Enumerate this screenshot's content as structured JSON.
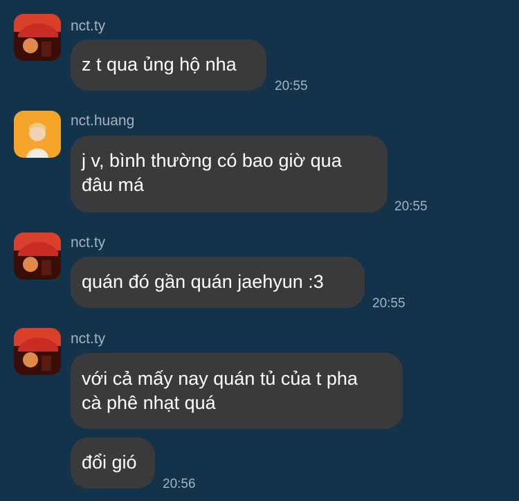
{
  "messages": [
    {
      "sender": "nct.ty",
      "avatar": "avatar-red-cap-icon",
      "text": "z t qua ủng hộ nha",
      "time": "20:55"
    },
    {
      "sender": "nct.huang",
      "avatar": "avatar-portrait-icon",
      "text": "j v, bình thường có bao giờ qua\nđâu má",
      "time": "20:55"
    },
    {
      "sender": "nct.ty",
      "avatar": "avatar-red-cap-icon",
      "text": "quán đó gần quán jaehyun :3",
      "time": "20:55"
    },
    {
      "sender": "nct.ty",
      "avatar": "avatar-red-cap-icon",
      "text": "với cả mấy nay quán tủ của t pha\ncà phê nhạt quá",
      "time": null
    },
    {
      "sender": null,
      "avatar": null,
      "text": "đổi gió",
      "time": "20:56"
    }
  ],
  "colors": {
    "background": "#13334b",
    "bubble": "#3a3a3c",
    "meta_text": "#a4b3c1",
    "message_text": "#ffffff"
  }
}
